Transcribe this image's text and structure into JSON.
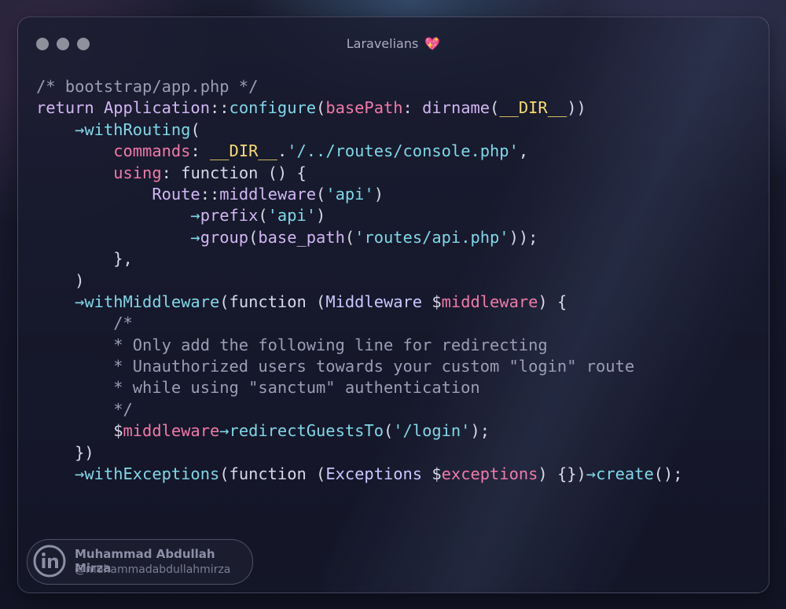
{
  "window": {
    "title": "Laravelians",
    "title_emoji": "💖"
  },
  "code_lines": [
    [
      {
        "t": "/* bootstrap/app.php */",
        "c": "cm"
      }
    ],
    [
      {
        "t": "return ",
        "c": "kw"
      },
      {
        "t": "Application",
        "c": "kw"
      },
      {
        "t": "::",
        "c": "pl"
      },
      {
        "t": "configure",
        "c": "fn"
      },
      {
        "t": "(",
        "c": "pl"
      },
      {
        "t": "basePath",
        "c": "pr"
      },
      {
        "t": ": ",
        "c": "pl"
      },
      {
        "t": "dirname",
        "c": "kw"
      },
      {
        "t": "(",
        "c": "pl"
      },
      {
        "t": "__DIR__",
        "c": "mg"
      },
      {
        "t": "))",
        "c": "pl"
      }
    ],
    [
      {
        "t": "    ",
        "c": "pl"
      },
      {
        "t": "→",
        "c": "ar"
      },
      {
        "t": "withRouting",
        "c": "fn"
      },
      {
        "t": "(",
        "c": "pl"
      }
    ],
    [
      {
        "t": "        ",
        "c": "pl"
      },
      {
        "t": "commands",
        "c": "pr"
      },
      {
        "t": ": ",
        "c": "pl"
      },
      {
        "t": "__DIR__",
        "c": "mg"
      },
      {
        "t": ".",
        "c": "pl"
      },
      {
        "t": "'/../routes/console.php'",
        "c": "st"
      },
      {
        "t": ",",
        "c": "pl"
      }
    ],
    [
      {
        "t": "        ",
        "c": "pl"
      },
      {
        "t": "using",
        "c": "pr"
      },
      {
        "t": ": function () {",
        "c": "pl"
      }
    ],
    [
      {
        "t": "            ",
        "c": "pl"
      },
      {
        "t": "Route",
        "c": "kw"
      },
      {
        "t": "::",
        "c": "pl"
      },
      {
        "t": "middleware",
        "c": "kw"
      },
      {
        "t": "(",
        "c": "pl"
      },
      {
        "t": "'api'",
        "c": "st"
      },
      {
        "t": ")",
        "c": "pl"
      }
    ],
    [
      {
        "t": "                ",
        "c": "pl"
      },
      {
        "t": "→",
        "c": "ar"
      },
      {
        "t": "prefix",
        "c": "kw"
      },
      {
        "t": "(",
        "c": "pl"
      },
      {
        "t": "'api'",
        "c": "st"
      },
      {
        "t": ")",
        "c": "pl"
      }
    ],
    [
      {
        "t": "                ",
        "c": "pl"
      },
      {
        "t": "→",
        "c": "ar"
      },
      {
        "t": "group",
        "c": "kw"
      },
      {
        "t": "(",
        "c": "pl"
      },
      {
        "t": "base_path",
        "c": "kw"
      },
      {
        "t": "(",
        "c": "pl"
      },
      {
        "t": "'routes/api.php'",
        "c": "st"
      },
      {
        "t": "));",
        "c": "pl"
      }
    ],
    [
      {
        "t": "        },",
        "c": "pl"
      }
    ],
    [
      {
        "t": "    )",
        "c": "pl"
      }
    ],
    [
      {
        "t": "    ",
        "c": "pl"
      },
      {
        "t": "→",
        "c": "ar"
      },
      {
        "t": "withMiddleware",
        "c": "fn"
      },
      {
        "t": "(function (",
        "c": "pl"
      },
      {
        "t": "Middleware",
        "c": "cl"
      },
      {
        "t": " $",
        "c": "pl"
      },
      {
        "t": "middleware",
        "c": "pr"
      },
      {
        "t": ") {",
        "c": "pl"
      }
    ],
    [
      {
        "t": "        /*",
        "c": "cm"
      }
    ],
    [
      {
        "t": "        * Only add the following line for redirecting",
        "c": "cm"
      }
    ],
    [
      {
        "t": "        * Unauthorized users towards your custom \"login\" route",
        "c": "cm"
      }
    ],
    [
      {
        "t": "        * while using \"sanctum\" authentication",
        "c": "cm"
      }
    ],
    [
      {
        "t": "        */",
        "c": "cm"
      }
    ],
    [
      {
        "t": "        $",
        "c": "pl"
      },
      {
        "t": "middleware",
        "c": "pr"
      },
      {
        "t": "→",
        "c": "ar"
      },
      {
        "t": "redirectGuestsTo",
        "c": "fn"
      },
      {
        "t": "(",
        "c": "pl"
      },
      {
        "t": "'/login'",
        "c": "st"
      },
      {
        "t": ");",
        "c": "pl"
      }
    ],
    [
      {
        "t": "    })",
        "c": "pl"
      }
    ],
    [
      {
        "t": "    ",
        "c": "pl"
      },
      {
        "t": "→",
        "c": "ar"
      },
      {
        "t": "withExceptions",
        "c": "fn"
      },
      {
        "t": "(function (",
        "c": "pl"
      },
      {
        "t": "Exceptions",
        "c": "cl"
      },
      {
        "t": " $",
        "c": "pl"
      },
      {
        "t": "exceptions",
        "c": "pr"
      },
      {
        "t": ") {})",
        "c": "pl"
      },
      {
        "t": "→",
        "c": "ar"
      },
      {
        "t": "create",
        "c": "fn"
      },
      {
        "t": "();",
        "c": "pl"
      }
    ]
  ],
  "author": {
    "name": "Muhammad Abdullah Mirza",
    "handle": "@muhammadabdullahmirza",
    "icon": "linkedin-icon"
  },
  "colors": {
    "comment": "#9a9db4",
    "keyword": "#d1b6f2",
    "function": "#7fd8e8",
    "param": "#f07aa8",
    "magic": "#f7dc6f",
    "string": "#7fd8e8",
    "class": "#c9c6ff",
    "heart": "#f04c7a"
  }
}
